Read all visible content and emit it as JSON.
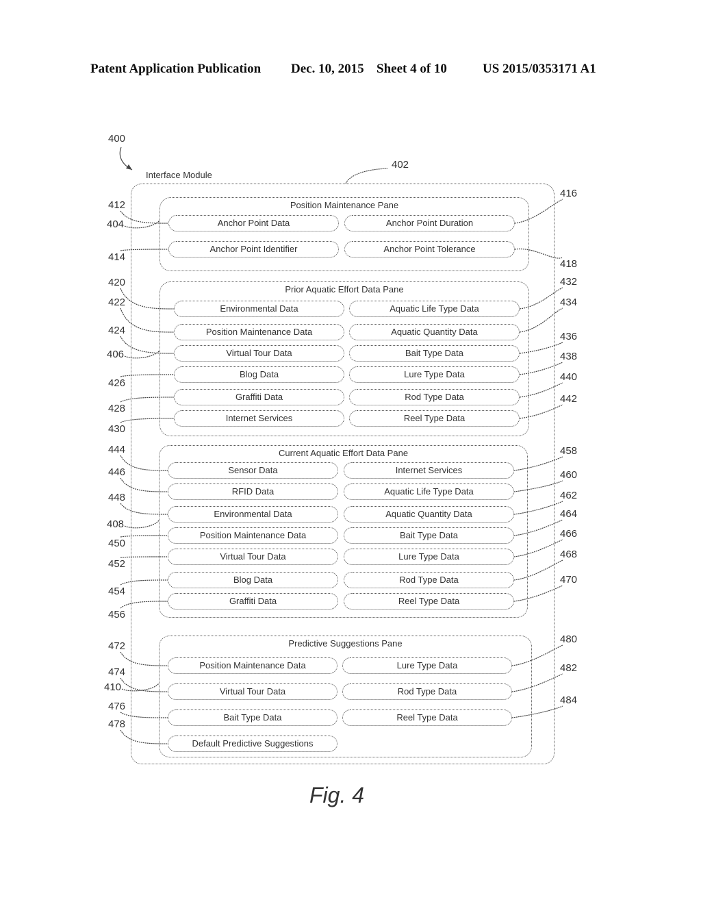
{
  "header": {
    "publication": "Patent Application Publication",
    "date": "Dec. 10, 2015",
    "sheet": "Sheet 4 of 10",
    "number": "US 2015/0353171 A1"
  },
  "figure": {
    "ref": "400",
    "caption": "Fig. 4"
  },
  "module": {
    "label": "Interface Module",
    "ref": "402"
  },
  "panes": [
    {
      "title": "Position Maintenance Pane",
      "ref": "404",
      "left": [
        {
          "label": "Anchor Point Data",
          "ref": "412"
        },
        {
          "label": "Anchor Point Identifier",
          "ref": "414"
        }
      ],
      "right": [
        {
          "label": "Anchor Point Duration",
          "ref": "416"
        },
        {
          "label": "Anchor Point Tolerance",
          "ref": "418"
        }
      ]
    },
    {
      "title": "Prior Aquatic Effort Data Pane",
      "ref": "406",
      "left": [
        {
          "label": "Environmental Data",
          "ref": "420"
        },
        {
          "label": "Position Maintenance Data",
          "ref": "422"
        },
        {
          "label": "Virtual Tour Data",
          "ref": "424"
        },
        {
          "label": "Blog Data",
          "ref": "426"
        },
        {
          "label": "Graffiti Data",
          "ref": "428"
        },
        {
          "label": "Internet Services",
          "ref": "430"
        }
      ],
      "right": [
        {
          "label": "Aquatic Life Type Data",
          "ref": "432"
        },
        {
          "label": "Aquatic Quantity Data",
          "ref": "434"
        },
        {
          "label": "Bait Type Data",
          "ref": "436"
        },
        {
          "label": "Lure Type Data",
          "ref": "438"
        },
        {
          "label": "Rod Type Data",
          "ref": "440"
        },
        {
          "label": "Reel Type Data",
          "ref": "442"
        }
      ]
    },
    {
      "title": "Current Aquatic Effort Data Pane",
      "ref": "408",
      "left": [
        {
          "label": "Sensor Data",
          "ref": "444"
        },
        {
          "label": "RFID Data",
          "ref": "446"
        },
        {
          "label": "Environmental Data",
          "ref": "448"
        },
        {
          "label": "Position Maintenance Data",
          "ref": "450"
        },
        {
          "label": "Virtual Tour Data",
          "ref": "452"
        },
        {
          "label": "Blog Data",
          "ref": "454"
        },
        {
          "label": "Graffiti Data",
          "ref": "456"
        }
      ],
      "right": [
        {
          "label": "Internet Services",
          "ref": "458"
        },
        {
          "label": "Aquatic Life Type Data",
          "ref": "460"
        },
        {
          "label": "Aquatic Quantity Data",
          "ref": "462"
        },
        {
          "label": "Bait Type Data",
          "ref": "464"
        },
        {
          "label": "Lure Type Data",
          "ref": "466"
        },
        {
          "label": "Rod Type Data",
          "ref": "468"
        },
        {
          "label": "Reel Type Data",
          "ref": "470"
        }
      ]
    },
    {
      "title": "Predictive Suggestions Pane",
      "ref": "410",
      "left": [
        {
          "label": "Position Maintenance Data",
          "ref": "472"
        },
        {
          "label": "Virtual Tour Data",
          "ref": "474"
        },
        {
          "label": "Bait Type Data",
          "ref": "476"
        },
        {
          "label": "Default Predictive Suggestions",
          "ref": "478"
        }
      ],
      "right": [
        {
          "label": "Lure Type Data",
          "ref": "480"
        },
        {
          "label": "Rod Type Data",
          "ref": "482"
        },
        {
          "label": "Reel Type Data",
          "ref": "484"
        }
      ]
    }
  ]
}
